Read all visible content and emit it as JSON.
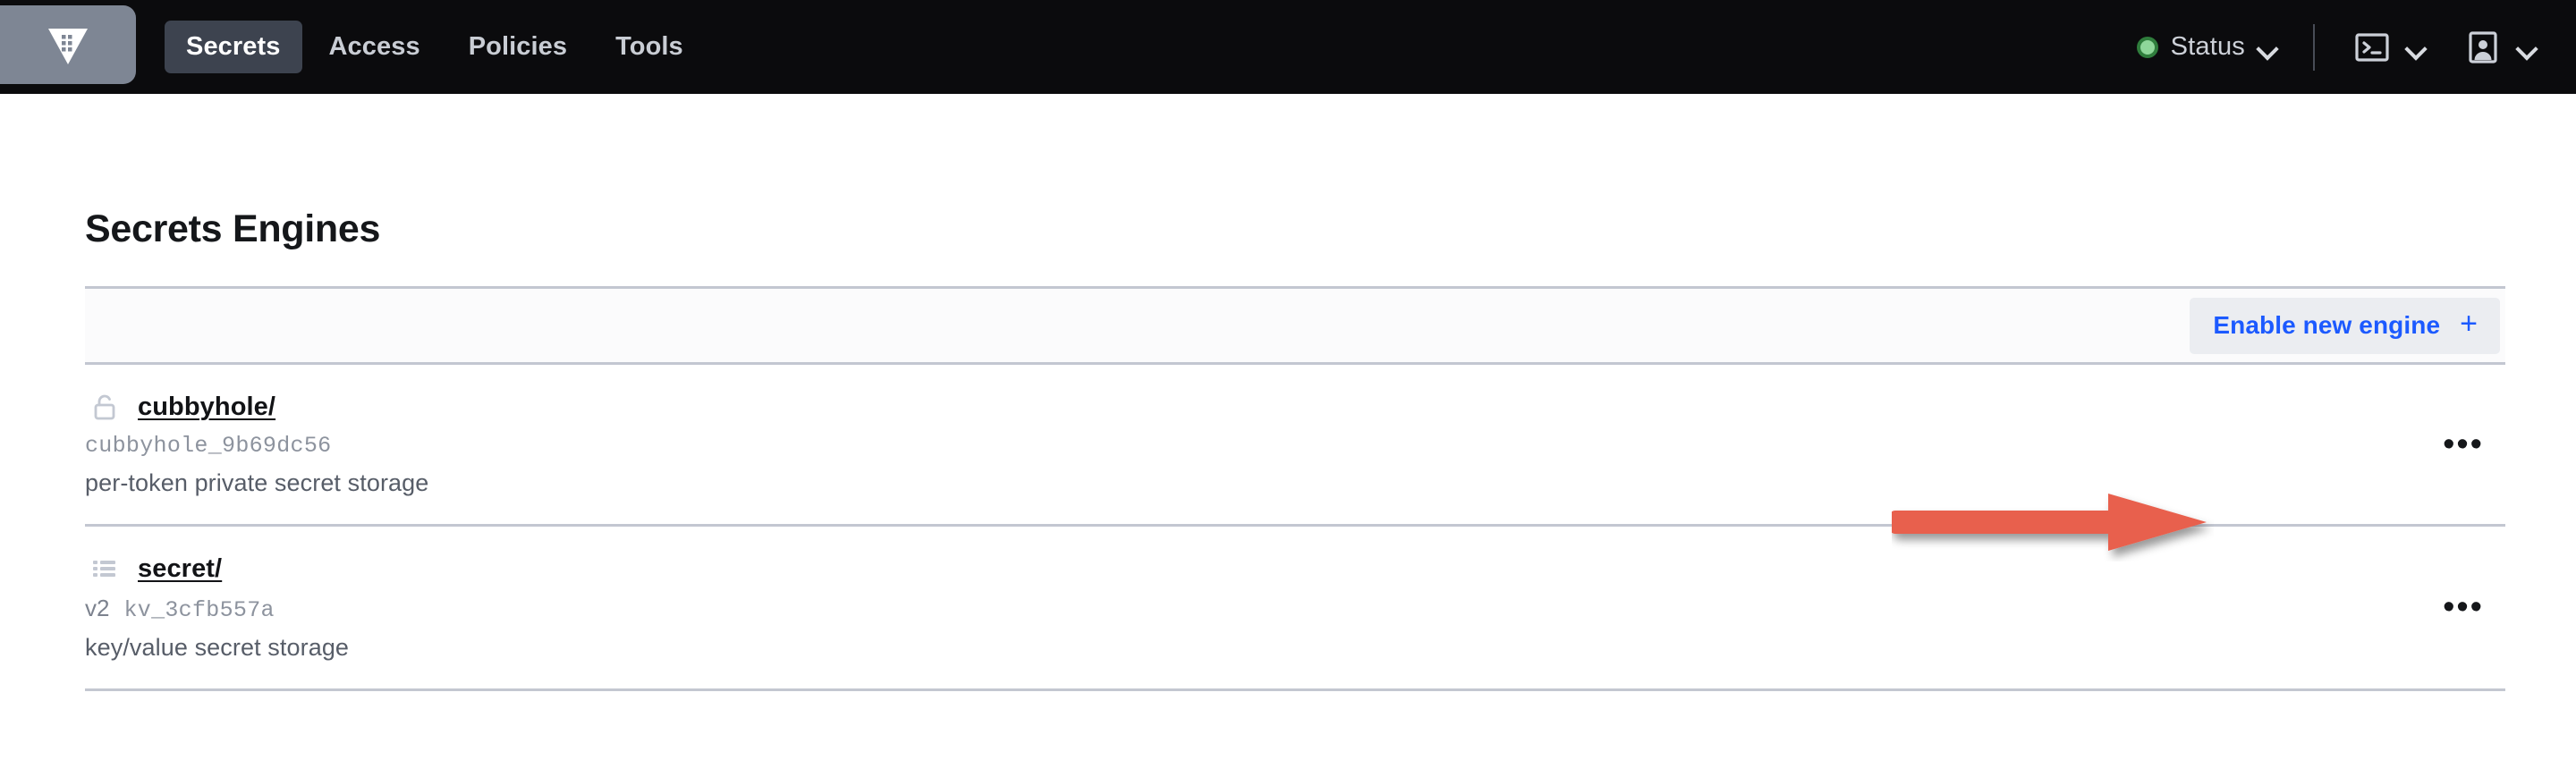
{
  "navbar": {
    "logo_icon": "vault-logo-icon",
    "tabs": [
      {
        "label": "Secrets",
        "active": true
      },
      {
        "label": "Access",
        "active": false
      },
      {
        "label": "Policies",
        "active": false
      },
      {
        "label": "Tools",
        "active": false
      }
    ],
    "status": {
      "label": "Status",
      "indicator_color": "#8fd79a",
      "indicator_ring_color": "#2f7d3c",
      "chevron_icon": "chevron-down-icon"
    },
    "console": {
      "icon": "terminal-icon",
      "chevron_icon": "chevron-down-icon"
    },
    "user": {
      "icon": "user-badge-icon",
      "chevron_icon": "chevron-down-icon"
    }
  },
  "main": {
    "title": "Secrets Engines",
    "toolbar": {
      "enable_button_label": "Enable new engine",
      "enable_button_plus": "+",
      "enable_button_text_color": "#1c5aff",
      "enable_button_bg": "#ebedf1"
    },
    "annotation": {
      "type": "arrow",
      "color": "#e8604d",
      "points_to": "enable-new-engine-button"
    },
    "engines": [
      {
        "name": "cubbyhole/",
        "icon": "unlock-icon",
        "version": "",
        "accessor": "cubbyhole_9b69dc56",
        "description": "per-token private secret storage",
        "menu_label": "•••"
      },
      {
        "name": "secret/",
        "icon": "list-icon",
        "version": "v2",
        "accessor": "kv_3cfb557a",
        "description": "key/value secret storage",
        "menu_label": "•••"
      }
    ]
  }
}
